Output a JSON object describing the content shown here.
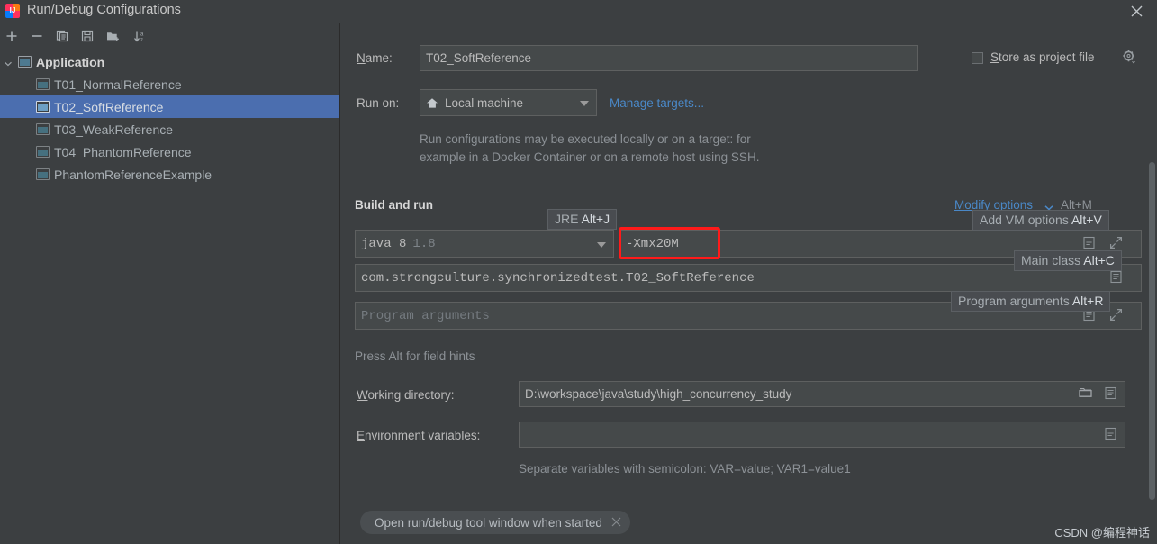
{
  "window": {
    "title": "Run/Debug Configurations",
    "app_icon": "intellij-idea-icon",
    "close_icon": "close-icon"
  },
  "toolbar": {
    "buttons": [
      {
        "name": "add-configuration-button",
        "icon": "plus-icon"
      },
      {
        "name": "remove-configuration-button",
        "icon": "minus-icon"
      },
      {
        "name": "copy-configuration-button",
        "icon": "copy-icon"
      },
      {
        "name": "save-configuration-button",
        "icon": "save-icon"
      },
      {
        "name": "new-folder-button",
        "icon": "new-folder-icon"
      },
      {
        "name": "sort-configurations-button",
        "icon": "sort-alphabetically-icon"
      }
    ]
  },
  "tree": {
    "group": {
      "label": "Application",
      "icon": "application-icon",
      "expanded": true
    },
    "items": [
      {
        "label": "T01_NormalReference",
        "selected": false
      },
      {
        "label": "T02_SoftReference",
        "selected": true
      },
      {
        "label": "T03_WeakReference",
        "selected": false
      },
      {
        "label": "T04_PhantomReference",
        "selected": false
      },
      {
        "label": "PhantomReferenceExample",
        "selected": false
      }
    ]
  },
  "form": {
    "name_label": "Name:",
    "name_value": "T02_SoftReference",
    "store_as_project_file_label": "Store as project file",
    "store_as_project_file_checked": false,
    "store_gear_icon": "gear-icon",
    "run_on_label": "Run on:",
    "run_on_value": "Local machine",
    "run_on_icon": "home-icon",
    "manage_targets_link": "Manage targets...",
    "run_on_description": "Run configurations may be executed locally or on a target: for\nexample in a Docker Container or on a remote host using SSH.",
    "build_and_run_title": "Build and run",
    "modify_options_link": "Modify options",
    "modify_options_shortcut": "Alt+M",
    "jre_value_primary": "java 8",
    "jre_value_secondary": "1.8",
    "vm_options_value": "-Xmx20M",
    "main_class_value": "com.strongculture.synchronizedtest.T02_SoftReference",
    "program_arguments_placeholder": "Program arguments",
    "field_hints_note": "Press Alt for field hints",
    "working_directory_label": "Working directory:",
    "working_directory_value": "D:\\workspace\\java\\study\\high_concurrency_study",
    "environment_variables_label": "Environment variables:",
    "environment_variables_value": "",
    "environment_variables_note": "Separate variables with semicolon: VAR=value; VAR1=value1",
    "open_tool_window_chip": "Open run/debug tool window when started",
    "chip_close_icon": "close-icon"
  },
  "hints": [
    {
      "name": "hint-jre",
      "text": "JRE ",
      "accent": "Alt+J"
    },
    {
      "name": "hint-vm-options",
      "text": "Add VM options ",
      "accent": "Alt+V"
    },
    {
      "name": "hint-main-class",
      "text": "Main class ",
      "accent": "Alt+C"
    },
    {
      "name": "hint-program-arguments",
      "text": "Program arguments ",
      "accent": "Alt+R"
    }
  ],
  "annotation": {
    "highlight_color": "#ff1a1a",
    "highlight_target": "vm-options-field"
  },
  "watermark": "CSDN @编程神话",
  "colors": {
    "background": "#3c3f41",
    "selection": "#4b6eaf",
    "link": "#4a88c7",
    "field_background": "#45494a",
    "border": "#2b2b2b"
  }
}
